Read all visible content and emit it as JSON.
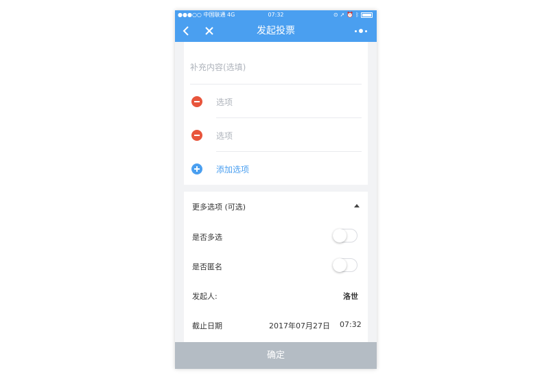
{
  "status_bar": {
    "carrier": "●●●○○ 中国联通  4G",
    "time": "07:32",
    "icons": [
      "lock-rotation-icon",
      "location-icon",
      "alarm-icon",
      "bluetooth-icon",
      "battery-icon"
    ]
  },
  "nav": {
    "title": "发起投票",
    "back_icon": "chevron-left-icon",
    "close_icon": "close-icon",
    "more_icon": "more-dots-icon"
  },
  "form": {
    "supplement_placeholder": "补充内容(选填)",
    "options": [
      {
        "placeholder": "选项"
      },
      {
        "placeholder": "选项"
      }
    ],
    "add_option_label": "添加选项"
  },
  "more_options": {
    "header": "更多选项 (可选)",
    "multi_select_label": "是否多选",
    "multi_select_on": false,
    "anonymous_label": "是否匿名",
    "anonymous_on": false,
    "initiator_label": "发起人:",
    "initiator_value": "洛世",
    "deadline_label": "截止日期",
    "deadline_date": "2017年07月27日",
    "deadline_time": "07:32"
  },
  "confirm_label": "确定",
  "colors": {
    "accent": "#4a9ff0",
    "remove": "#e8553c",
    "disabled_button": "#b4bcc4"
  }
}
